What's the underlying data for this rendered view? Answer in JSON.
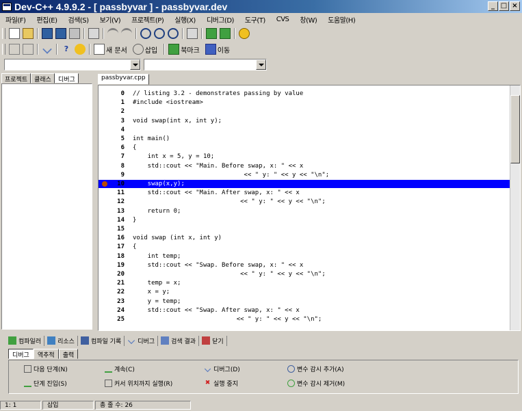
{
  "window": {
    "title": "Dev-C++ 4.9.9.2  - [ passbyvar ] - passbyvar.dev"
  },
  "menubar": {
    "items": [
      "파일(F)",
      "편집(E)",
      "검색(S)",
      "보기(V)",
      "프로젝트(P)",
      "실행(X)",
      "디버그(D)",
      "도구(T)",
      "CVS",
      "창(W)",
      "도움말(H)"
    ]
  },
  "toolbar": {
    "insert_label": "삽입",
    "toggle_label": "북마크",
    "goto_label": "이동",
    "new_label": "새 문서"
  },
  "left_tabs": [
    "프로젝트",
    "클래스",
    "디버그"
  ],
  "file_tab": "passbyvar.cpp",
  "code": {
    "highlight_index": 10,
    "breakpoint_index": 10,
    "lines": [
      {
        "n": "0",
        "t": "// listing 3.2 - demonstrates passing by value"
      },
      {
        "n": "1",
        "t": "#include <iostream>"
      },
      {
        "n": "2",
        "t": ""
      },
      {
        "n": "3",
        "t": "void swap(int x, int y);"
      },
      {
        "n": "4",
        "t": ""
      },
      {
        "n": "5",
        "t": "int main()"
      },
      {
        "n": "6",
        "t": "{"
      },
      {
        "n": "7",
        "t": "    int x = 5, y = 10;"
      },
      {
        "n": "8",
        "t": "    std::cout << \"Main. Before swap, x: \" << x"
      },
      {
        "n": "9",
        "t": "                              << \" y: \" << y << \"\\n\";"
      },
      {
        "n": "10",
        "t": "    swap(x,y);"
      },
      {
        "n": "11",
        "t": "    std::cout << \"Main. After swap, x: \" << x"
      },
      {
        "n": "12",
        "t": "                             << \" y: \" << y << \"\\n\";"
      },
      {
        "n": "13",
        "t": "    return 0;"
      },
      {
        "n": "14",
        "t": "}"
      },
      {
        "n": "15",
        "t": ""
      },
      {
        "n": "16",
        "t": "void swap (int x, int y)"
      },
      {
        "n": "17",
        "t": "{"
      },
      {
        "n": "18",
        "t": "    int temp;"
      },
      {
        "n": "19",
        "t": "    std::cout << \"Swap. Before swap, x: \" << x"
      },
      {
        "n": "20",
        "t": "                             << \" y: \" << y << \"\\n\";"
      },
      {
        "n": "21",
        "t": "    temp = x;"
      },
      {
        "n": "22",
        "t": "    x = y;"
      },
      {
        "n": "23",
        "t": "    y = temp;"
      },
      {
        "n": "24",
        "t": "    std::cout << \"Swap. After swap, x: \" << x"
      },
      {
        "n": "25",
        "t": "                            << \" y: \" << y << \"\\n\";"
      }
    ]
  },
  "bottom_tabs": [
    "컴파일러",
    "리소스",
    "컴파일 기록",
    "디버그",
    "검색 결과",
    "닫기"
  ],
  "sub_tabs": [
    "디버그",
    "역추적",
    "출력"
  ],
  "debug_buttons": [
    "다음 단계(N)",
    "계속(C)",
    "디버그(D)",
    "변수 감시 추가(A)",
    "단계 진입(S)",
    "커서 위치까지 실행(R)",
    "실행 중지",
    "변수 감시 제거(M)"
  ],
  "statusbar": {
    "pos": "1: 1",
    "mode": "삽입",
    "lines": "총 줄 수: 26"
  }
}
